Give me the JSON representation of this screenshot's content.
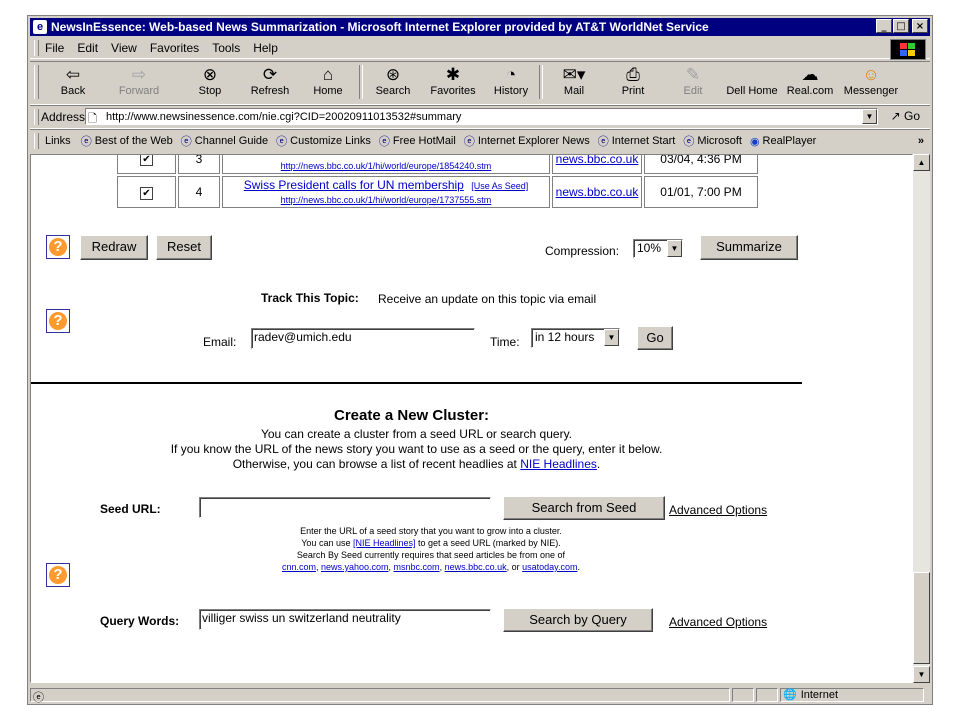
{
  "window": {
    "title": "NewsInEssence: Web-based News Summarization - Microsoft Internet Explorer provided by AT&T WorldNet Service"
  },
  "menu": [
    "File",
    "Edit",
    "View",
    "Favorites",
    "Tools",
    "Help"
  ],
  "toolbar": [
    {
      "label": "Back",
      "icon": "back-arrow-icon"
    },
    {
      "label": "Forward",
      "icon": "forward-arrow-icon"
    },
    {
      "label": "Stop",
      "icon": "stop-icon"
    },
    {
      "label": "Refresh",
      "icon": "refresh-icon"
    },
    {
      "label": "Home",
      "icon": "home-icon"
    },
    {
      "label": "Search",
      "icon": "search-icon"
    },
    {
      "label": "Favorites",
      "icon": "favorites-icon"
    },
    {
      "label": "History",
      "icon": "history-icon"
    },
    {
      "label": "Mail",
      "icon": "mail-icon"
    },
    {
      "label": "Print",
      "icon": "print-icon"
    },
    {
      "label": "Edit",
      "icon": "edit-icon"
    },
    {
      "label": "Dell Home"
    },
    {
      "label": "Real.com",
      "icon": "real-icon"
    },
    {
      "label": "Messenger",
      "icon": "messenger-icon"
    }
  ],
  "address": {
    "label": "Address",
    "url": "http://www.newsinessence.com/nie.cgi?CID=20020911013532#summary",
    "go": "Go"
  },
  "links": {
    "label": "Links",
    "items": [
      "Best of the Web",
      "Channel Guide",
      "Customize Links",
      "Free HotMail",
      "Internet Explorer News",
      "Internet Start",
      "Microsoft",
      "RealPlayer"
    ],
    "more": "»"
  },
  "results": {
    "row_partial": {
      "num": "3",
      "url": "http://news.bbc.co.uk/1/hi/world/europe/1854240.stm",
      "source": "news.bbc.co.uk",
      "date": "03/04, 4:36 PM"
    },
    "row": {
      "num": "4",
      "title": "Swiss President calls for UN membership",
      "use_seed": "[Use As Seed]",
      "url": "http://news.bbc.co.uk/1/hi/world/europe/1737555.stm",
      "source": "news.bbc.co.uk",
      "date": "01/01, 7:00 PM"
    }
  },
  "controls": {
    "redraw": "Redraw",
    "reset": "Reset",
    "compression_label": "Compression:",
    "compression_value": "10%",
    "summarize": "Summarize"
  },
  "track": {
    "heading": "Track This Topic:",
    "text": "Receive an update on this topic via email",
    "email_label": "Email:",
    "email_value": "radev@umich.edu",
    "time_label": "Time:",
    "time_value": "in 12 hours",
    "go": "Go"
  },
  "cluster": {
    "heading": "Create a New Cluster:",
    "line1": "You can create a cluster from a seed URL or search query.",
    "line2": "If you know the URL of the news story you want to use as a seed or the query, enter it below.",
    "line3_pre": "Otherwise, you can browse a list of recent headlies at ",
    "line3_link": "NIE Headlines",
    "line3_post": ".",
    "seed_label": "Seed URL:",
    "seed_value": "",
    "seed_button": "Search from Seed",
    "advanced1": "Advanced Options",
    "note1": "Enter the URL of a seed story that you want to grow into a cluster.",
    "note2_pre": "You can use ",
    "note2_link": "[NIE Headlines]",
    "note2_post": " to get a seed URL (marked by NIE).",
    "note3": "Search By Seed currently requires that seed articles be from one of",
    "sites": [
      "cnn.com",
      "news.yahoo.com",
      "msnbc.com",
      "news.bbc.co.uk",
      "usatoday.com"
    ],
    "sites_sep": ", ",
    "sites_or": ", or ",
    "sites_end": ".",
    "query_label": "Query Words:",
    "query_value": "villiger swiss un switzerland neutrality",
    "query_button": "Search by Query",
    "advanced2": "Advanced Options"
  },
  "status": {
    "zone": "Internet"
  }
}
